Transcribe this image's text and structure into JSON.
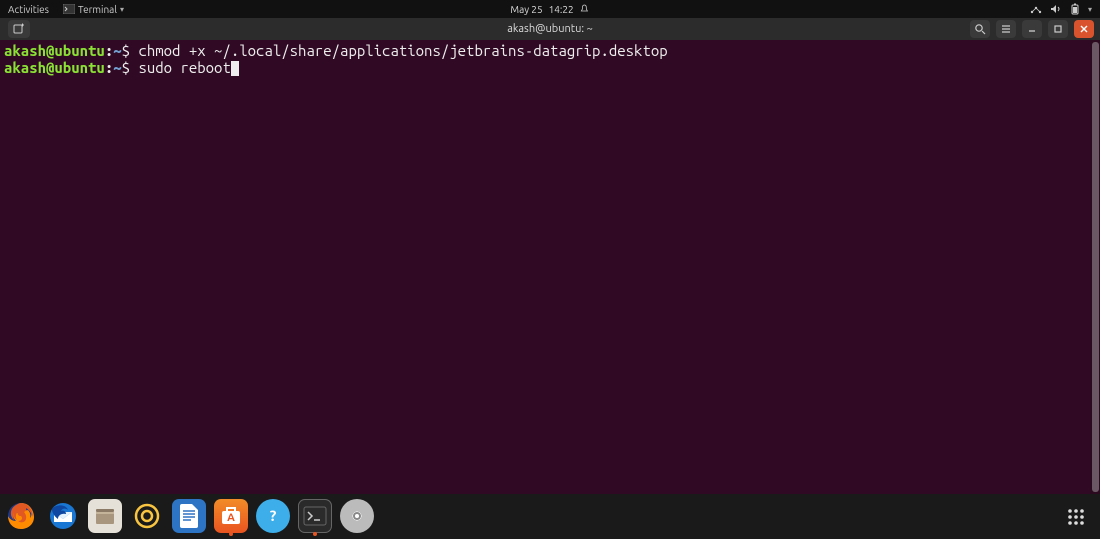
{
  "topbar": {
    "activities_label": "Activities",
    "app_menu": {
      "icon": "terminal-icon",
      "label": "Terminal"
    },
    "clock": {
      "date": "May 25",
      "time": "14:22"
    },
    "status": {
      "network_icon": "network-icon",
      "volume_icon": "volume-icon",
      "battery_icon": "battery-icon",
      "dropdown_icon": "chevron-down-icon"
    }
  },
  "window": {
    "title": "akash@ubuntu: ~",
    "new_tab_button": "new-tab-icon",
    "search_button": "search-icon",
    "menu_button": "hamburger-icon",
    "minimize_button": "minimize-icon",
    "maximize_button": "maximize-icon",
    "close_button": "close-icon"
  },
  "terminal": {
    "lines": [
      {
        "user": "akash@ubuntu",
        "path": "~",
        "command": "chmod +x ~/.local/share/applications/jetbrains-datagrip.desktop"
      },
      {
        "user": "akash@ubuntu",
        "path": "~",
        "command": "sudo reboot",
        "cursor": true
      }
    ]
  },
  "dock": {
    "items": [
      {
        "name": "firefox-icon"
      },
      {
        "name": "thunderbird-icon"
      },
      {
        "name": "files-icon"
      },
      {
        "name": "rhythmbox-icon"
      },
      {
        "name": "libreoffice-writer-icon"
      },
      {
        "name": "ubuntu-software-icon"
      },
      {
        "name": "help-icon"
      },
      {
        "name": "terminal-icon",
        "running": true,
        "active": true
      },
      {
        "name": "disc-icon"
      }
    ],
    "apps_button": "apps-grid-icon"
  }
}
